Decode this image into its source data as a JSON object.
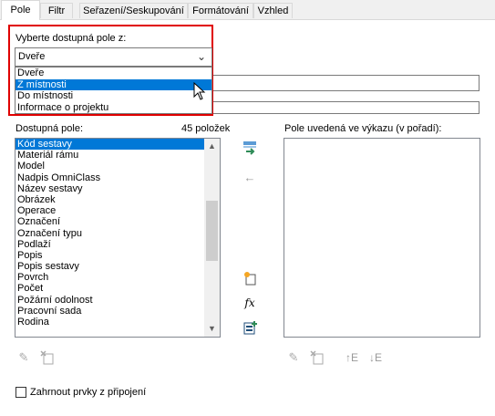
{
  "tabs": [
    "Pole",
    "Filtr",
    "Seřazení/Seskupování",
    "Formátování",
    "Vzhled"
  ],
  "select_fields_from": {
    "label": "Vyberte dostupná pole z:",
    "value": "Dveře",
    "options": [
      "Dveře",
      "Z místnosti",
      "Do místnosti",
      "Informace o projektu"
    ],
    "highlighted": "Z místnosti"
  },
  "available": {
    "label": "Dostupná pole:",
    "count_text": "45 položek",
    "items": [
      "Kód sestavy",
      "Materiál rámu",
      "Model",
      "Nadpis OmniClass",
      "Název sestavy",
      "Obrázek",
      "Operace",
      "Označení",
      "Označení typu",
      "Podlaží",
      "Popis",
      "Popis sestavy",
      "Povrch",
      "Počet",
      "Požární odolnost",
      "Pracovní sada",
      "Rodina"
    ],
    "selected": "Kód sestavy"
  },
  "scheduled": {
    "label": "Pole uvedená ve výkazu (v pořadí):",
    "items": []
  },
  "include_linked": {
    "label": "Zahrnout prvky z připojení",
    "checked": false
  },
  "icons": {
    "add": "add-parameter-icon",
    "remove": "remove-parameter-icon",
    "new_param": "new-parameter-icon",
    "calc": "calculated-value-icon",
    "combine": "combine-parameters-icon",
    "edit": "edit-parameter-icon",
    "delete": "delete-parameter-icon",
    "move_up": "move-up-icon",
    "move_down": "move-down-icon"
  }
}
